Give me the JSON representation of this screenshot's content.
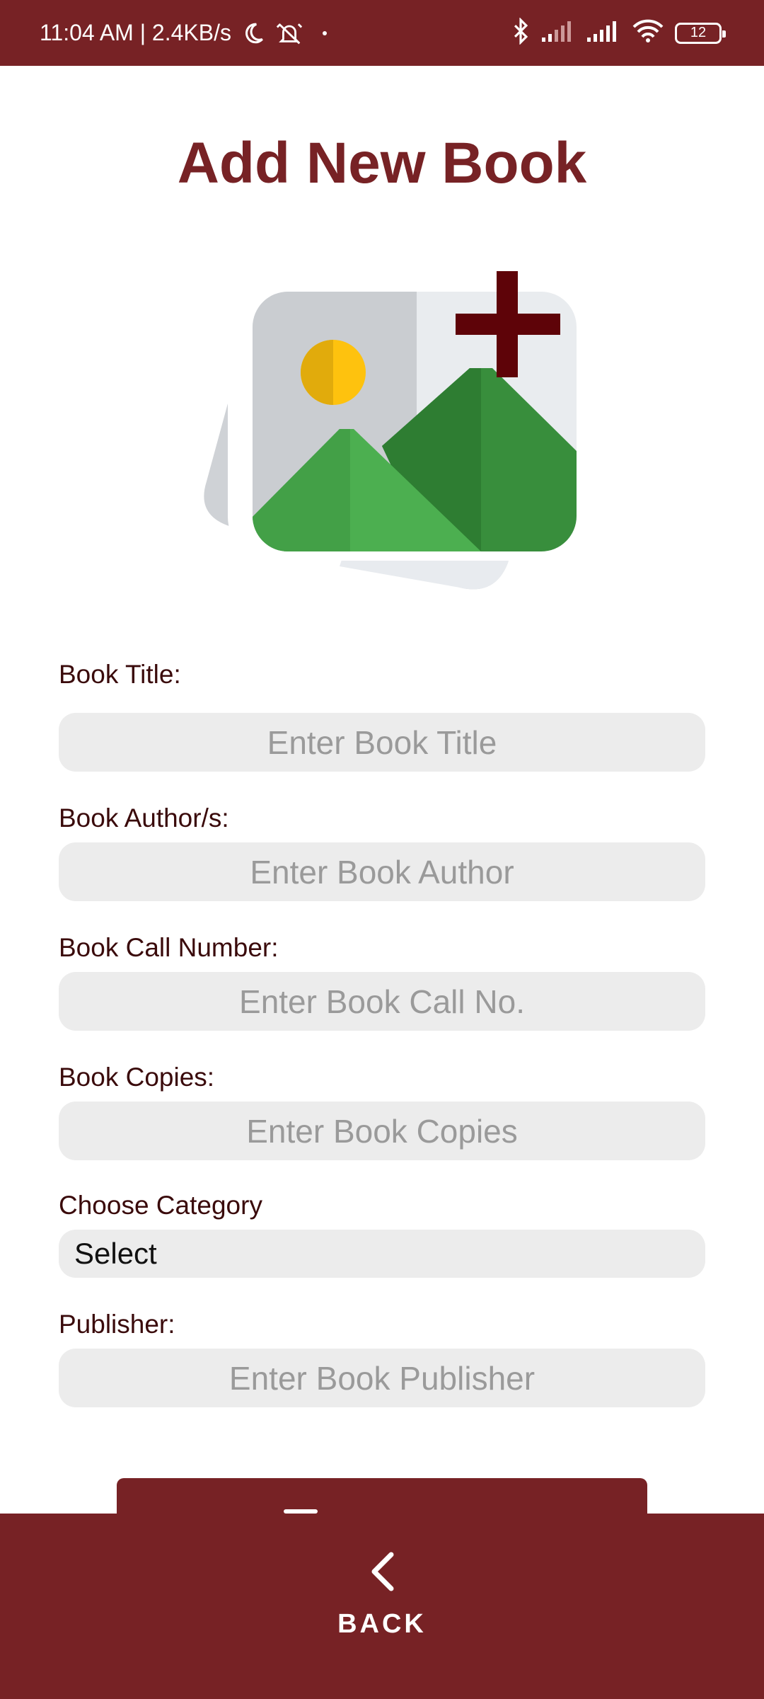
{
  "status_bar": {
    "time_speed": "11:04 AM | 2.4KB/s",
    "battery": "12",
    "icons": [
      "moon-icon",
      "alarm-off-icon",
      "dot-icon",
      "bluetooth-icon",
      "signal-icon",
      "signal-icon",
      "wifi-icon",
      "battery-icon"
    ]
  },
  "page": {
    "title": "Add New Book"
  },
  "image": {
    "icon": "add-image-icon"
  },
  "form": {
    "title_label": "Book Title:",
    "title_placeholder": "Enter Book Title",
    "author_label": "Book Author/s:",
    "author_placeholder": "Enter Book Author",
    "call_label": "Book Call Number:",
    "call_placeholder": "Enter Book Call No.",
    "copies_label": "Book Copies:",
    "copies_placeholder": "Enter Book Copies",
    "category_label": "Choose Category",
    "category_value": "Select",
    "publisher_label": "Publisher:",
    "publisher_placeholder": "Enter Book Publisher"
  },
  "footer": {
    "back_label": "BACK"
  },
  "colors": {
    "primary": "#772225",
    "field_bg": "#ececec",
    "placeholder": "#9a9a9a"
  }
}
